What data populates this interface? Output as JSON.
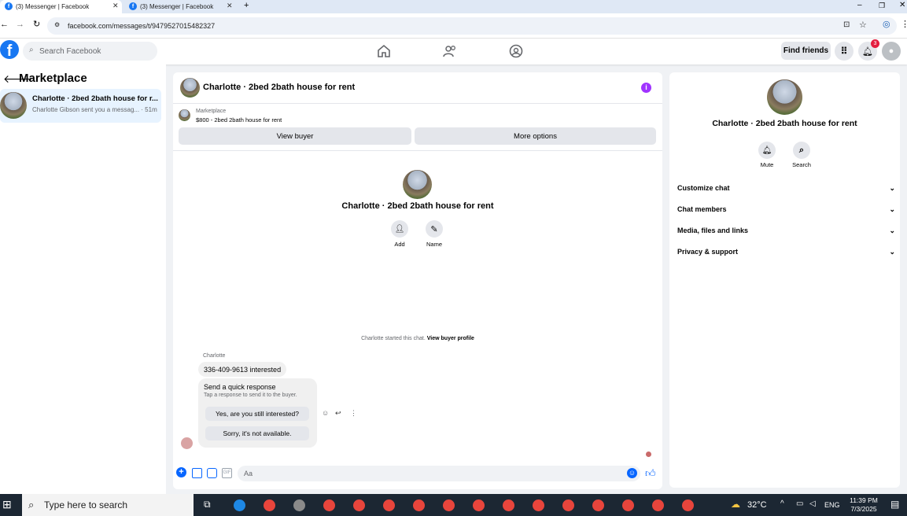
{
  "browser": {
    "tabs": [
      {
        "label": "(3) Messenger | Facebook"
      },
      {
        "label": "(3) Messenger | Facebook"
      }
    ],
    "url": "facebook.com/messages/t/9479527015482327"
  },
  "header": {
    "search_placeholder": "Search Facebook",
    "find_friends_label": "Find friends",
    "notification_count": "3",
    "brand_color": "#1877f2"
  },
  "left_panel": {
    "title": "Marketplace",
    "conversation": {
      "name": "Charlotte · 2bed 2bath house for r...",
      "preview": "Charlotte Gibson sent you a messag... · 51m"
    }
  },
  "chat": {
    "title": "Charlotte · 2bed 2bath house for rent",
    "marketplace_label": "Marketplace",
    "marketplace_item": "$800 - 2bed 2bath house for rent",
    "view_buyer_label": "View buyer",
    "more_options_label": "More options",
    "center_title": "Charlotte · 2bed 2bath house for rent",
    "add_label": "Add",
    "name_label": "Name",
    "started_text": "Charlotte started this chat.",
    "view_buyer_profile": "View buyer profile",
    "sender": "Charlotte",
    "message": "336-409-9613 interested",
    "quick_response_title": "Send a quick response",
    "quick_response_sub": "Tap a response to send it to the buyer.",
    "quick_responses": [
      "Yes, are you still interested?",
      "Sorry, it's not available."
    ],
    "composer_placeholder": "Aa"
  },
  "right_panel": {
    "title": "Charlotte · 2bed 2bath house for rent",
    "mute_label": "Mute",
    "search_label": "Search",
    "sections": [
      "Customize chat",
      "Chat members",
      "Media, files and links",
      "Privacy & support"
    ]
  },
  "taskbar": {
    "search_placeholder": "Type here to search",
    "weather": "32°C",
    "language": "ENG",
    "time": "11:39 PM",
    "date": "7/3/2025"
  }
}
